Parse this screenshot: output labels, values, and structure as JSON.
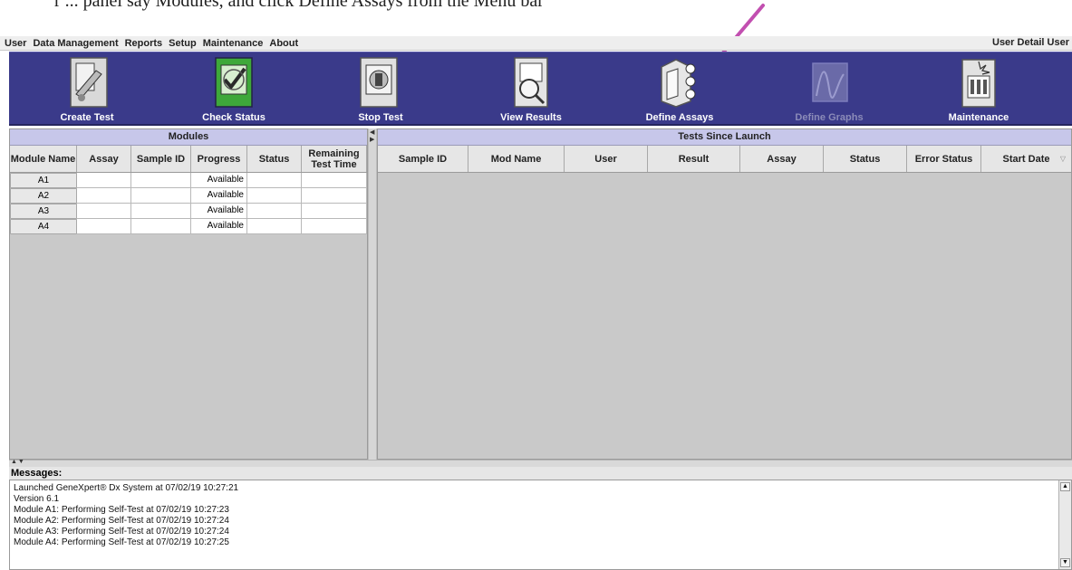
{
  "document": {
    "caption": "r ... panel say Modules, and click Define Assays from the Menu bar",
    "arrow_color": "#c24fb0"
  },
  "menu": {
    "items": [
      "User",
      "Data Management",
      "Reports",
      "Setup",
      "Maintenance",
      "About"
    ],
    "user_detail": "User Detail User"
  },
  "toolbar": {
    "buttons": [
      {
        "label": "Create Test",
        "icon": "create-test-icon",
        "enabled": true
      },
      {
        "label": "Check Status",
        "icon": "check-status-icon",
        "enabled": true
      },
      {
        "label": "Stop Test",
        "icon": "stop-test-icon",
        "enabled": true
      },
      {
        "label": "View Results",
        "icon": "view-results-icon",
        "enabled": true
      },
      {
        "label": "Define Assays",
        "icon": "define-assays-icon",
        "enabled": true
      },
      {
        "label": "Define Graphs",
        "icon": "define-graphs-icon",
        "enabled": false
      },
      {
        "label": "Maintenance",
        "icon": "maintenance-icon",
        "enabled": true
      }
    ],
    "background": "#3a3a8a"
  },
  "modules": {
    "title": "Modules",
    "columns": [
      "Module Name",
      "Assay",
      "Sample ID",
      "Progress",
      "Status",
      "Remaining Test Time"
    ],
    "rows": [
      {
        "module": "A1",
        "assay": "",
        "sample_id": "",
        "progress": "Available",
        "status": "",
        "remaining": ""
      },
      {
        "module": "A2",
        "assay": "",
        "sample_id": "",
        "progress": "Available",
        "status": "",
        "remaining": ""
      },
      {
        "module": "A3",
        "assay": "",
        "sample_id": "",
        "progress": "Available",
        "status": "",
        "remaining": ""
      },
      {
        "module": "A4",
        "assay": "",
        "sample_id": "",
        "progress": "Available",
        "status": "",
        "remaining": ""
      }
    ]
  },
  "tests": {
    "title": "Tests Since Launch",
    "columns": [
      "Sample ID",
      "Mod Name",
      "User",
      "Result",
      "Assay",
      "Status",
      "Error Status",
      "Start Date"
    ]
  },
  "messages": {
    "label": "Messages:",
    "lines": [
      "Launched GeneXpert® Dx System at 07/02/19 10:27:21",
      "Version 6.1",
      "Module A1: Performing Self-Test at 07/02/19 10:27:23",
      "Module A2: Performing Self-Test at 07/02/19 10:27:24",
      "Module A3: Performing Self-Test at 07/02/19 10:27:24",
      "Module A4: Performing Self-Test at 07/02/19 10:27:25"
    ]
  }
}
